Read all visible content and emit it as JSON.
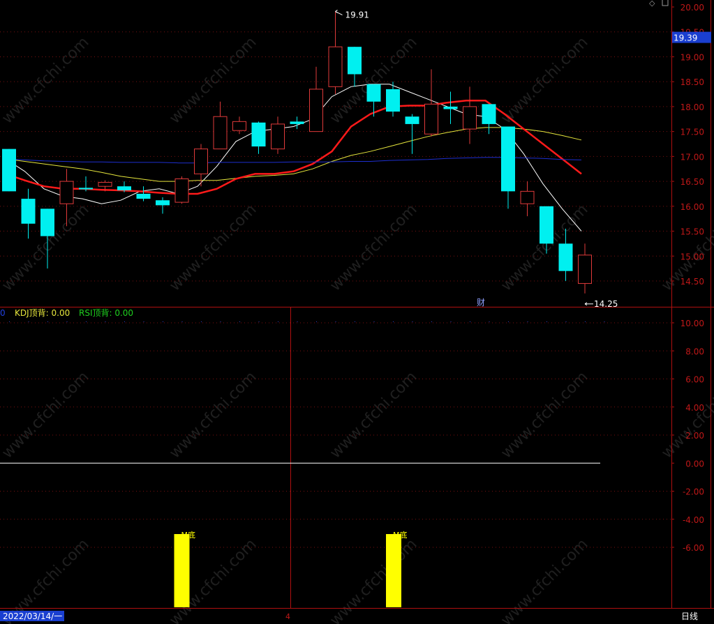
{
  "colors": {
    "up": "#e03a3a",
    "down": "#00f0f0",
    "ma_white": "#ffffff",
    "ma_yellow": "#e6e63c",
    "ma_red": "#ff1a1a",
    "ma_blue": "#1e2fd0",
    "axis_red": "#b01010",
    "grid": "#7a1010",
    "tick_label": "#c01818",
    "bar": "#ffff00",
    "zero_line": "#ffffff",
    "current_price_bg": "#1a3fd0"
  },
  "chart_data": [
    {
      "type": "candlestick",
      "ylim": [
        14.1,
        20.1
      ],
      "yticks": [
        "20.00",
        "19.50",
        "19.00",
        "18.50",
        "18.00",
        "17.50",
        "17.00",
        "16.50",
        "16.00",
        "15.50",
        "15.00",
        "14.50"
      ],
      "current_price": "19.39",
      "high_marker": "19.91",
      "low_marker": "14.25",
      "annotation": "财",
      "candles": [
        {
          "o": 17.15,
          "c": 16.3,
          "h": 17.15,
          "l": 16.3
        },
        {
          "o": 16.15,
          "c": 15.65,
          "h": 16.35,
          "l": 15.35
        },
        {
          "o": 15.95,
          "c": 15.4,
          "h": 15.95,
          "l": 14.75
        },
        {
          "o": 16.05,
          "c": 16.5,
          "h": 16.75,
          "l": 15.6
        },
        {
          "o": 16.37,
          "c": 16.34,
          "h": 16.6,
          "l": 16.3
        },
        {
          "o": 16.4,
          "c": 16.48,
          "h": 16.52,
          "l": 16.3
        },
        {
          "o": 16.4,
          "c": 16.32,
          "h": 16.5,
          "l": 16.28
        },
        {
          "o": 16.25,
          "c": 16.15,
          "h": 16.4,
          "l": 16.1
        },
        {
          "o": 16.12,
          "c": 16.02,
          "h": 16.18,
          "l": 15.85
        },
        {
          "o": 16.08,
          "c": 16.55,
          "h": 16.6,
          "l": 16.05
        },
        {
          "o": 16.65,
          "c": 17.15,
          "h": 17.25,
          "l": 16.4
        },
        {
          "o": 17.15,
          "c": 17.8,
          "h": 18.1,
          "l": 17.15
        },
        {
          "o": 17.52,
          "c": 17.7,
          "h": 17.8,
          "l": 17.45
        },
        {
          "o": 17.68,
          "c": 17.2,
          "h": 17.7,
          "l": 17.05
        },
        {
          "o": 17.15,
          "c": 17.65,
          "h": 17.8,
          "l": 17.05
        },
        {
          "o": 17.7,
          "c": 17.65,
          "h": 17.8,
          "l": 17.55
        },
        {
          "o": 17.5,
          "c": 18.35,
          "h": 18.8,
          "l": 17.5
        },
        {
          "o": 18.4,
          "c": 19.2,
          "h": 19.91,
          "l": 18.25
        },
        {
          "o": 19.2,
          "c": 18.65,
          "h": 19.2,
          "l": 18.4
        },
        {
          "o": 18.45,
          "c": 18.1,
          "h": 18.45,
          "l": 17.8
        },
        {
          "o": 18.35,
          "c": 17.9,
          "h": 18.5,
          "l": 17.8
        },
        {
          "o": 17.8,
          "c": 17.65,
          "h": 17.85,
          "l": 17.05
        },
        {
          "o": 17.45,
          "c": 18.05,
          "h": 18.75,
          "l": 17.4
        },
        {
          "o": 18.0,
          "c": 17.95,
          "h": 18.3,
          "l": 17.65
        },
        {
          "o": 17.55,
          "c": 18.0,
          "h": 18.4,
          "l": 17.25
        },
        {
          "o": 18.05,
          "c": 17.65,
          "h": 18.05,
          "l": 17.45
        },
        {
          "o": 17.6,
          "c": 16.3,
          "h": 17.6,
          "l": 15.95
        },
        {
          "o": 16.05,
          "c": 16.3,
          "h": 16.5,
          "l": 15.8
        },
        {
          "o": 16.0,
          "c": 15.25,
          "h": 16.0,
          "l": 15.05
        },
        {
          "o": 15.25,
          "c": 14.7,
          "h": 15.55,
          "l": 14.5
        },
        {
          "o": 14.45,
          "c": 15.02,
          "h": 15.25,
          "l": 14.25
        }
      ],
      "series": [
        {
          "values": [
            16.95,
            16.7,
            16.35,
            16.2,
            16.15,
            16.05,
            16.12,
            16.3,
            16.35,
            16.25,
            16.4,
            16.8,
            17.3,
            17.5,
            17.55,
            17.6,
            17.75,
            18.2,
            18.4,
            18.45,
            18.45,
            18.3,
            18.15,
            18.0,
            17.85,
            17.8,
            17.55,
            17.05,
            16.45,
            15.95,
            15.5
          ]
        },
        {
          "values": [
            16.95,
            16.9,
            16.85,
            16.8,
            16.75,
            16.68,
            16.6,
            16.55,
            16.5,
            16.5,
            16.52,
            16.52,
            16.56,
            16.6,
            16.62,
            16.65,
            16.75,
            16.9,
            17.02,
            17.1,
            17.2,
            17.3,
            17.4,
            17.48,
            17.55,
            17.58,
            17.58,
            17.55,
            17.5,
            17.42,
            17.33
          ]
        },
        {
          "values": [
            16.65,
            16.52,
            16.4,
            16.35,
            16.35,
            16.33,
            16.32,
            16.3,
            16.27,
            16.25,
            16.25,
            16.35,
            16.55,
            16.65,
            16.65,
            16.7,
            16.85,
            17.1,
            17.6,
            17.85,
            18.0,
            18.02,
            18.02,
            18.08,
            18.12,
            18.12,
            17.85,
            17.55,
            17.25,
            16.95,
            16.65
          ]
        },
        {
          "values": [
            16.95,
            16.93,
            16.91,
            16.9,
            16.89,
            16.89,
            16.88,
            16.88,
            16.88,
            16.87,
            16.87,
            16.88,
            16.88,
            16.88,
            16.88,
            16.89,
            16.89,
            16.89,
            16.9,
            16.9,
            16.92,
            16.93,
            16.94,
            16.96,
            16.97,
            16.98,
            16.98,
            16.97,
            16.96,
            16.94,
            16.93
          ]
        }
      ]
    },
    {
      "type": "bar",
      "ylim": [
        -10.1,
        11.0
      ],
      "yticks": [
        "10.00",
        "8.00",
        "6.00",
        "4.00",
        "2.00",
        "0.00",
        "-2.00",
        "-4.00",
        "-6.00"
      ],
      "bars": [
        {
          "index": 9,
          "label": "M底"
        },
        {
          "index": 20,
          "label": "M底"
        }
      ]
    }
  ],
  "indicator_bar": {
    "prefix": "0",
    "kdj_label": "KDJ顶背: 0.00",
    "rsi_label": "RSI顶背: 0.00",
    "kdj_color": "#e6e63c",
    "rsi_color": "#1ed01e"
  },
  "bottom_bar": {
    "date_text": "2022/03/14/一",
    "marker_text": "4",
    "period": "日线"
  },
  "watermark": "www.cfchi.com"
}
